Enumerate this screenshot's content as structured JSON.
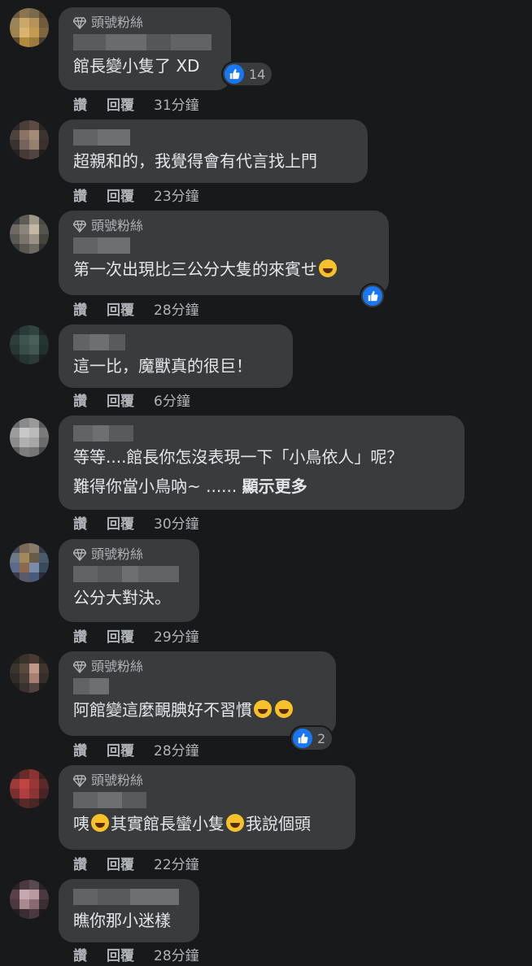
{
  "actions": {
    "like": "讚",
    "reply": "回覆"
  },
  "badge_label": "頭號粉絲",
  "colors": {
    "bg": "#18191a",
    "bubble": "#3a3b3c",
    "like_blue": "#1877f2"
  },
  "comments": [
    {
      "text": "館長變小隻了 XD",
      "time": "31分鐘",
      "reactions": "14"
    },
    {
      "text": "超親和的，我覺得會有代言找上門",
      "time": "23分鐘"
    },
    {
      "text": "第一次出現比三公分大隻的來賓せ",
      "time": "28分鐘"
    },
    {
      "text": "這一比，魔獸真的很巨！",
      "time": "6分鐘"
    },
    {
      "text": "等等....館長你怎沒表現一下「小鳥依人」呢？",
      "text2": "難得你當小鳥吶~ ......",
      "more": "顯示更多",
      "time": "30分鐘"
    },
    {
      "text": "公分大對決。",
      "time": "29分鐘"
    },
    {
      "text": "阿館變這麼靦腆好不習慣",
      "time": "28分鐘",
      "reactions": "2"
    },
    {
      "text_a": "咦",
      "text_b": "其實館長蠻小隻",
      "text_c": "我說個頭",
      "time": "22分鐘"
    },
    {
      "text": "瞧你那小迷樣",
      "time": "28分鐘"
    }
  ]
}
